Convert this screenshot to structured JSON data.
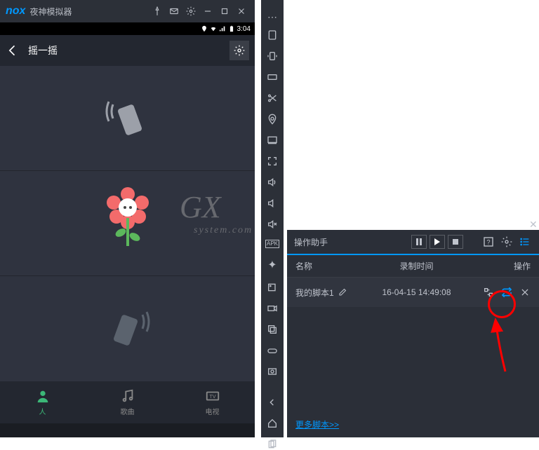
{
  "emulator": {
    "logo": "nox",
    "title": "夜神模拟器"
  },
  "device": {
    "time": "3:04"
  },
  "app": {
    "title": "摇一摇"
  },
  "nav": {
    "people": "人",
    "music": "歌曲",
    "tv": "电视"
  },
  "helper": {
    "title": "操作助手",
    "cols": {
      "name": "名称",
      "time": "录制时间",
      "ops": "操作"
    },
    "scripts": [
      {
        "name": "我的脚本1",
        "time": "16-04-15 14:49:08"
      }
    ],
    "more": "更多脚本>>"
  },
  "watermark": {
    "big": "GX",
    "small": "system.com"
  }
}
